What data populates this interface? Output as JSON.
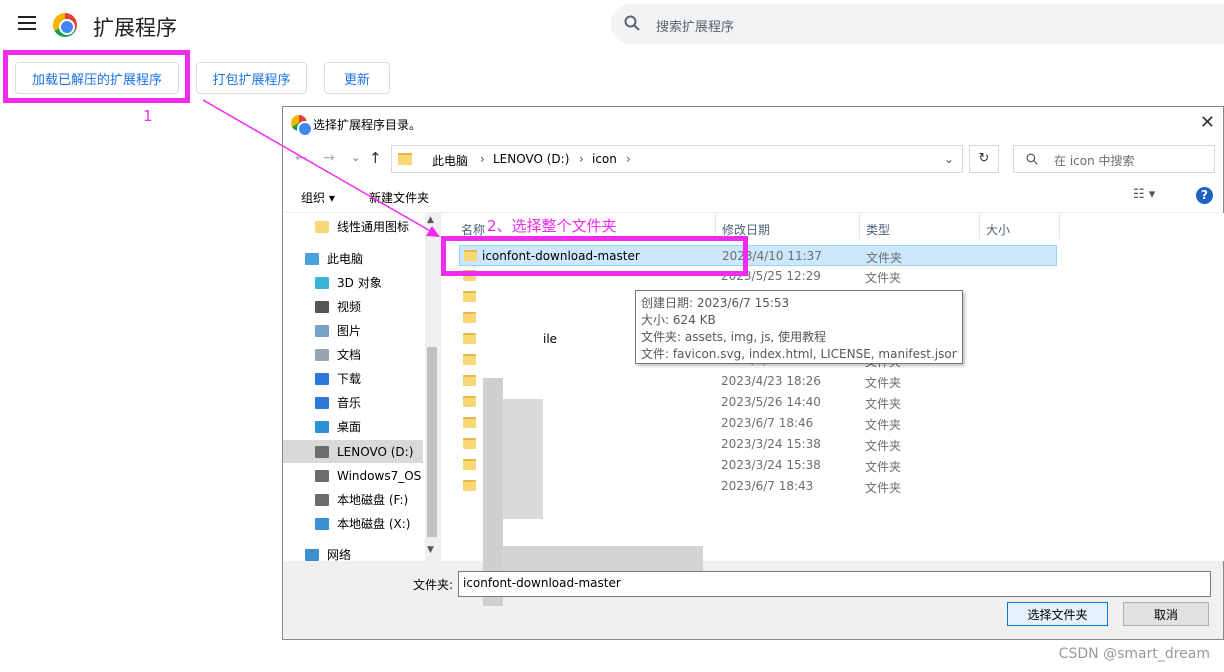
{
  "app": {
    "title": "扩展程序",
    "search_placeholder": "搜索扩展程序"
  },
  "toolbar": {
    "load_unpacked": "加载已解压的扩展程序",
    "pack": "打包扩展程序",
    "update": "更新"
  },
  "annotations": {
    "step1": "1",
    "step2": "2、选择整个文件夹"
  },
  "dialog": {
    "title": "选择扩展程序目录。",
    "path": [
      "此电脑",
      "LENOVO (D:)",
      "icon"
    ],
    "search_placeholder": "在 icon 中搜索",
    "organize": "组织 ▾",
    "new_folder": "新建文件夹",
    "nav": [
      {
        "label": "线性通用图标",
        "icon": "folder-icon",
        "color": "#f8d775"
      },
      {
        "label": "此电脑",
        "icon": "computer-icon",
        "color": "#4aa3df"
      },
      {
        "label": "3D 对象",
        "icon": "cube-icon",
        "color": "#3cb4d8"
      },
      {
        "label": "视频",
        "icon": "video-icon",
        "color": "#555555"
      },
      {
        "label": "图片",
        "icon": "picture-icon",
        "color": "#7aa0c8"
      },
      {
        "label": "文档",
        "icon": "document-icon",
        "color": "#9aa4ae"
      },
      {
        "label": "下载",
        "icon": "download-icon",
        "color": "#2b78d8"
      },
      {
        "label": "音乐",
        "icon": "music-icon",
        "color": "#2b78d8"
      },
      {
        "label": "桌面",
        "icon": "desktop-icon",
        "color": "#2b90d8"
      },
      {
        "label": "LENOVO (D:)",
        "icon": "drive-icon",
        "color": "#6d6d6d"
      },
      {
        "label": "Windows7_OS",
        "icon": "drive-icon",
        "color": "#6d6d6d"
      },
      {
        "label": "本地磁盘 (F:)",
        "icon": "drive-icon",
        "color": "#6d6d6d"
      },
      {
        "label": "本地磁盘 (X:)",
        "icon": "network-drive-icon",
        "color": "#3c8fd0"
      },
      {
        "label": "网络",
        "icon": "network-icon",
        "color": "#3c8fd0"
      }
    ],
    "columns": [
      "名称",
      "修改日期",
      "类型",
      "大小"
    ],
    "rows": [
      {
        "name": "iconfont-download-master",
        "date": "2023/4/10 11:37",
        "type": "文件夹"
      },
      {
        "name": "",
        "date": "2023/5/25 12:29",
        "type": "文件夹"
      },
      {
        "name": "",
        "date": "",
        "type": ""
      },
      {
        "name": "",
        "date": "",
        "type": ""
      },
      {
        "name": "ile",
        "date": "",
        "type": ""
      },
      {
        "name": "",
        "date": "2023/3/24 15:38",
        "type": "文件夹"
      },
      {
        "name": "",
        "date": "2023/4/23 18:26",
        "type": "文件夹"
      },
      {
        "name": "",
        "date": "2023/5/26 14:40",
        "type": "文件夹"
      },
      {
        "name": "",
        "date": "2023/6/7 18:46",
        "type": "文件夹"
      },
      {
        "name": "",
        "date": "2023/3/24 15:38",
        "type": "文件夹"
      },
      {
        "name": "",
        "date": "2023/3/24 15:38",
        "type": "文件夹"
      },
      {
        "name": "",
        "date": "2023/6/7 18:43",
        "type": "文件夹"
      }
    ],
    "tooltip": [
      "创建日期: 2023/6/7 15:53",
      "大小: 624 KB",
      "文件夹: assets, img, js, 使用教程",
      "文件: favicon.svg, index.html, LICENSE, manifest.json, ..."
    ],
    "folder_label": "文件夹:",
    "folder_value": "iconfont-download-master",
    "select_button": "选择文件夹",
    "cancel_button": "取消"
  },
  "watermark": "CSDN @smart_dream",
  "colors": {
    "highlight": "#ee2bee",
    "accent": "#1a73e8"
  }
}
